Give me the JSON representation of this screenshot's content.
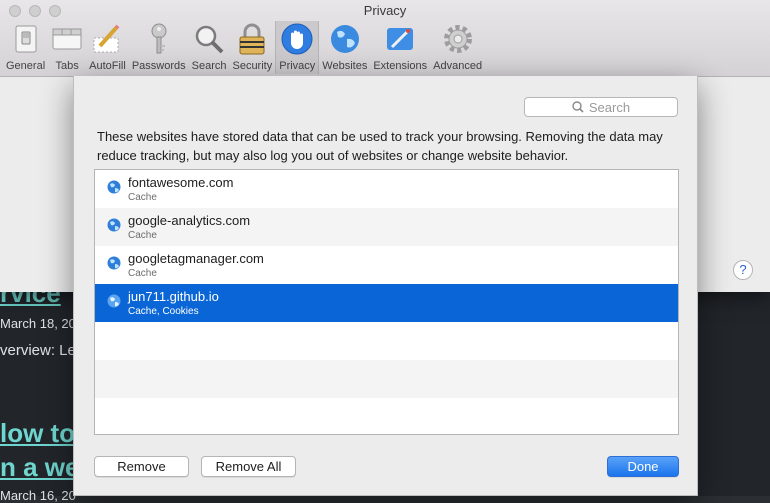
{
  "background_page": {
    "lines": [
      "rvice",
      "March 18, 20",
      "verview: Le",
      "low to",
      "n a we",
      "March 16, 20"
    ]
  },
  "window": {
    "title": "Privacy",
    "toolbar": [
      {
        "label": "General",
        "icon": "general-switch-icon"
      },
      {
        "label": "Tabs",
        "icon": "tabs-icon"
      },
      {
        "label": "AutoFill",
        "icon": "autofill-pencil-icon"
      },
      {
        "label": "Passwords",
        "icon": "key-icon"
      },
      {
        "label": "Search",
        "icon": "magnifier-icon"
      },
      {
        "label": "Security",
        "icon": "padlock-icon"
      },
      {
        "label": "Privacy",
        "icon": "privacy-hand-icon",
        "active": true
      },
      {
        "label": "Websites",
        "icon": "globe-icon"
      },
      {
        "label": "Extensions",
        "icon": "extensions-puzzle-icon"
      },
      {
        "label": "Advanced",
        "icon": "gear-icon"
      }
    ],
    "help_label": "?"
  },
  "sheet": {
    "search_placeholder": "Search",
    "description": "These websites have stored data that can be used to track your browsing. Removing the data may reduce tracking, but may also log you out of websites or change website behavior.",
    "websites": [
      {
        "name": "fontawesome.com",
        "data": "Cache"
      },
      {
        "name": "google-analytics.com",
        "data": "Cache"
      },
      {
        "name": "googletagmanager.com",
        "data": "Cache"
      },
      {
        "name": "jun711.github.io",
        "data": "Cache, Cookies",
        "selected": true
      }
    ],
    "remove_label": "Remove",
    "remove_all_label": "Remove All",
    "done_label": "Done"
  },
  "colors": {
    "accent": "#0a66d6",
    "heading": "#6fd6cf"
  }
}
